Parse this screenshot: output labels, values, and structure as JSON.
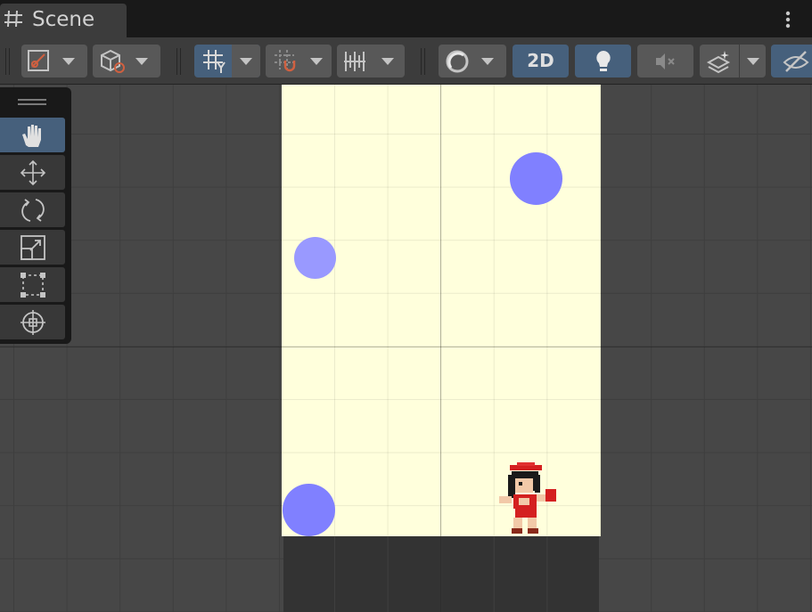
{
  "window": {
    "tab_label": "Scene"
  },
  "toolbar": {
    "mode_2d_label": "2D",
    "icons": [
      "tool-handle-icon",
      "draw-mode-icon",
      "grid-snap-icon",
      "increment-snap-icon",
      "ruler-snap-icon",
      "shading-icon",
      "lighting-icon",
      "audio-mute-icon",
      "effects-icon",
      "visibility-icon"
    ],
    "active_color": "#46607c"
  },
  "tools": [
    "hand-tool",
    "move-tool",
    "rotate-tool",
    "scale-tool",
    "rect-tool",
    "transform-tool"
  ],
  "scene": {
    "camera_background": "#ffffdc",
    "ball_colors": [
      "#8080ff",
      "#9999ff",
      "#8080ff"
    ],
    "character": "red-hat-girl-sprite"
  }
}
